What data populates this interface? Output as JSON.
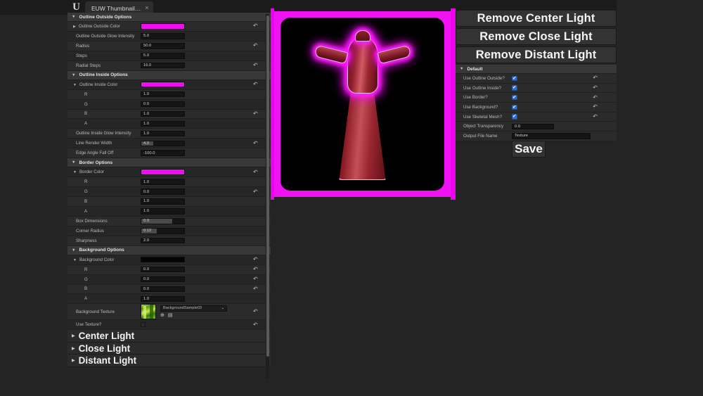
{
  "window": {
    "tab_label": "EUW Thumbnail…",
    "close_icon": "×",
    "logo": "U"
  },
  "left_panel": {
    "sections": [
      {
        "title": "Outline Outside Options",
        "rows": [
          {
            "label": "Outline Outside Color",
            "type": "color",
            "color": "#f20cf2",
            "indent": 0,
            "expander": "▶",
            "revert": true
          },
          {
            "label": "Outline Outside Glow Intensity",
            "type": "value",
            "value": "5.0",
            "indent": 1,
            "revert": false
          },
          {
            "label": "Radius",
            "type": "value",
            "value": "50.0",
            "indent": 1,
            "revert": true
          },
          {
            "label": "Steps",
            "type": "value",
            "value": "5.0",
            "indent": 1,
            "revert": false
          },
          {
            "label": "Radial Steps",
            "type": "value",
            "value": "16.0",
            "indent": 1,
            "revert": true
          }
        ]
      },
      {
        "title": "Outline Inside Options",
        "rows": [
          {
            "label": "Outline Inside Color",
            "type": "color",
            "color": "#f20cf2",
            "indent": 0,
            "expander": "▼",
            "revert": true
          },
          {
            "label": "R",
            "type": "value",
            "value": "1.0",
            "indent": 2,
            "revert": false
          },
          {
            "label": "G",
            "type": "value",
            "value": "0.0",
            "indent": 2,
            "revert": false
          },
          {
            "label": "B",
            "type": "value",
            "value": "1.0",
            "indent": 2,
            "revert": true
          },
          {
            "label": "A",
            "type": "value",
            "value": "1.0",
            "indent": 2,
            "revert": false
          },
          {
            "label": "Outline Inside Glow Intensity",
            "type": "value",
            "value": "1.0",
            "indent": 1,
            "revert": false
          },
          {
            "label": "Line Render Width",
            "type": "slider",
            "value": "4.0",
            "fill": 28,
            "indent": 1,
            "revert": true
          },
          {
            "label": "Edge Angle Fall Off",
            "type": "value",
            "value": "-100.0",
            "indent": 1,
            "revert": false
          }
        ]
      },
      {
        "title": "Border Options",
        "rows": [
          {
            "label": "Border Color",
            "type": "color",
            "color": "#f20cf2",
            "indent": 0,
            "expander": "▼",
            "revert": true
          },
          {
            "label": "R",
            "type": "value",
            "value": "1.0",
            "indent": 2,
            "revert": false
          },
          {
            "label": "G",
            "type": "value",
            "value": "0.0",
            "indent": 2,
            "revert": true
          },
          {
            "label": "B",
            "type": "value",
            "value": "1.0",
            "indent": 2,
            "revert": false
          },
          {
            "label": "A",
            "type": "value",
            "value": "1.0",
            "indent": 2,
            "revert": false
          },
          {
            "label": "Box Dimensions",
            "type": "slider",
            "value": "0.9",
            "fill": 72,
            "indent": 1,
            "revert": false
          },
          {
            "label": "Corner Radius",
            "type": "slider",
            "value": "0.12",
            "fill": 36,
            "indent": 1,
            "revert": false
          },
          {
            "label": "Sharpness",
            "type": "value",
            "value": "2.0",
            "indent": 1,
            "revert": false
          }
        ]
      },
      {
        "title": "Background Options",
        "rows": [
          {
            "label": "Background Color",
            "type": "color",
            "color": "#050505",
            "indent": 0,
            "expander": "▼",
            "revert": true
          },
          {
            "label": "R",
            "type": "value",
            "value": "0.0",
            "indent": 2,
            "revert": true
          },
          {
            "label": "G",
            "type": "value",
            "value": "0.0",
            "indent": 2,
            "revert": true
          },
          {
            "label": "B",
            "type": "value",
            "value": "0.0",
            "indent": 2,
            "revert": true
          },
          {
            "label": "A",
            "type": "value",
            "value": "1.0",
            "indent": 2,
            "revert": false
          }
        ]
      }
    ],
    "texture_row": {
      "label": "Background Texture",
      "asset_name": "BackgroundSample03",
      "chevron": "⌄",
      "browse_icon": "⊕",
      "use_icon": "▤",
      "revert": true
    },
    "use_texture_row": {
      "label": "Use Texture?",
      "checked": false,
      "revert": true
    },
    "light_sections": [
      {
        "label": "Center Light",
        "expander": "▶"
      },
      {
        "label": "Close Light",
        "expander": "▶"
      },
      {
        "label": "Distant Light",
        "expander": "▶"
      }
    ]
  },
  "right_panel": {
    "buttons": [
      "Remove Center Light",
      "Remove Close Light",
      "Remove Distant Light"
    ],
    "section_title": "Default",
    "section_expander": "▼",
    "rows": [
      {
        "label": "Use Outline Outside?",
        "type": "check",
        "checked": true,
        "revert": true
      },
      {
        "label": "Use Outline Inside?",
        "type": "check",
        "checked": true,
        "revert": true
      },
      {
        "label": "Use Border?",
        "type": "check",
        "checked": true,
        "revert": true
      },
      {
        "label": "Use Background?",
        "type": "check",
        "checked": true,
        "revert": true
      },
      {
        "label": "Use Skeletal Mesh?",
        "type": "check",
        "checked": true,
        "revert": true
      },
      {
        "label": "Object Transparency",
        "type": "value",
        "value": "0.0",
        "revert": false
      },
      {
        "label": "Output File Name",
        "type": "text",
        "value": "Texture",
        "revert": false
      }
    ],
    "save_label": "Save"
  },
  "viewport": {
    "description": "Thumbnail preview: red gown with magenta outline glow on black background",
    "border_color": "#f012f0",
    "background_color": "#000000"
  },
  "icons": {
    "revert": "↶",
    "check": "✔"
  }
}
